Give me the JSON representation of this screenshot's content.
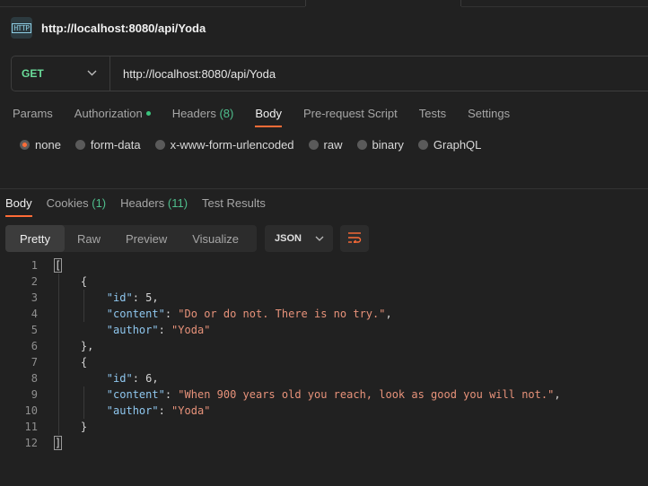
{
  "request": {
    "icon": "http-file-icon",
    "icon_label": "HTTP",
    "title": "http://localhost:8080/api/Yoda",
    "method": "GET",
    "url": "http://localhost:8080/api/Yoda"
  },
  "request_tabs": [
    {
      "label": "Params",
      "count": ""
    },
    {
      "label": "Authorization",
      "count": ""
    },
    {
      "label": "Headers",
      "count": "(8)"
    },
    {
      "label": "Body",
      "count": ""
    },
    {
      "label": "Pre-request Script",
      "count": ""
    },
    {
      "label": "Tests",
      "count": ""
    },
    {
      "label": "Settings",
      "count": ""
    }
  ],
  "body_types": [
    "none",
    "form-data",
    "x-www-form-urlencoded",
    "raw",
    "binary",
    "GraphQL"
  ],
  "response_tabs": [
    {
      "label": "Body",
      "count": ""
    },
    {
      "label": "Cookies",
      "count": "(1)"
    },
    {
      "label": "Headers",
      "count": "(11)"
    },
    {
      "label": "Test Results",
      "count": ""
    }
  ],
  "view_modes": [
    "Pretty",
    "Raw",
    "Preview",
    "Visualize"
  ],
  "format": "JSON",
  "line_numbers": [
    "1",
    "2",
    "3",
    "4",
    "5",
    "6",
    "7",
    "8",
    "9",
    "10",
    "11",
    "12"
  ],
  "response": [
    {
      "id": 5,
      "content": "Do or do not. There is no try.",
      "author": "Yoda"
    },
    {
      "id": 6,
      "content": "When 900 years old you reach, look as good you will not.",
      "author": "Yoda"
    }
  ],
  "colors": {
    "accent": "#ff6c37",
    "method": "#6bdd9a",
    "json_key": "#8fc7ef",
    "json_string": "#e7927a",
    "count": "#4fbf8d"
  }
}
